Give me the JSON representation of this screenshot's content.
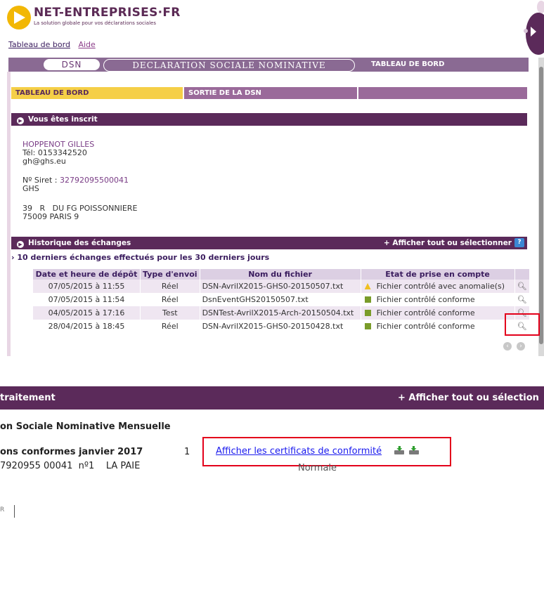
{
  "header": {
    "logo_name": "NET-ENTREPRISES·FR",
    "logo_tagline": "La solution globale pour vos déclarations sociales",
    "links": [
      "Tableau de bord",
      "Aide"
    ]
  },
  "appbar": {
    "short": "DSN",
    "long": "DECLARATION SOCIALE NOMINATIVE",
    "title": "TABLEAU DE BORD"
  },
  "tabs": [
    {
      "label": "TABLEAU DE BORD",
      "active": true
    },
    {
      "label": "SORTIE DE LA DSN",
      "active": false
    },
    {
      "label": "",
      "active": false
    }
  ],
  "registered": {
    "title": "Vous êtes inscrit",
    "name": "HOPPENOT GILLES",
    "phone": "Tél: 0153342520",
    "email": "gh@ghs.eu",
    "siret_label": "Nº Siret : ",
    "siret": "32792095500041",
    "company": "GHS",
    "address1": "39   R   DU FG POISSONNIERE",
    "address2": "75009 PARIS 9"
  },
  "history": {
    "title": "Historique des échanges",
    "show_all": "+ Afficher tout ou sélectionner",
    "help": "?",
    "summary": "10 derniers échanges effectués pour les 30 derniers jours",
    "columns": [
      "Date et heure de dépôt",
      "Type d'envoi",
      "Nom du fichier",
      "Etat de prise en compte",
      ""
    ],
    "rows": [
      {
        "date": "07/05/2015 à 11:55",
        "type": "Réel",
        "file": "DSN-AvrilX2015-GHS0-20150507.txt",
        "state": "Fichier contrôlé avec anomalie(s)",
        "status_icon": "warning-icon"
      },
      {
        "date": "07/05/2015 à 11:54",
        "type": "Réel",
        "file": "DsnEventGHS20150507.txt",
        "state": "Fichier contrôlé conforme",
        "status_icon": "check-icon"
      },
      {
        "date": "04/05/2015 à 17:16",
        "type": "Test",
        "file": "DSNTest-AvrilX2015-Arch-20150504.txt",
        "state": "Fichier contrôlé conforme",
        "status_icon": "check-icon"
      },
      {
        "date": "28/04/2015 à 18:45",
        "type": "Réel",
        "file": "DSN-AvrilX2015-GHS0-20150428.txt",
        "state": "Fichier contrôlé conforme",
        "status_icon": "check-icon"
      }
    ],
    "view_icon": "magnifier-icon"
  },
  "panel2": {
    "bar_left": "traitement",
    "bar_right": "+ Afficher tout ou sélection",
    "heading": "on Sociale Nominative Mensuelle",
    "conform_label": "ons conformes janvier 2017",
    "count": "1",
    "cert_link": "Afficher les certificats de conformité",
    "siret_line": "7920955 00041  nº1    LA PAIE",
    "nature": "Normale",
    "fragment": "R"
  },
  "colors": {
    "brand_purple": "#5b2a5a",
    "tab_active": "#f5cf47",
    "highlight_red": "#e3001b",
    "link_blue": "#1a1aee"
  }
}
